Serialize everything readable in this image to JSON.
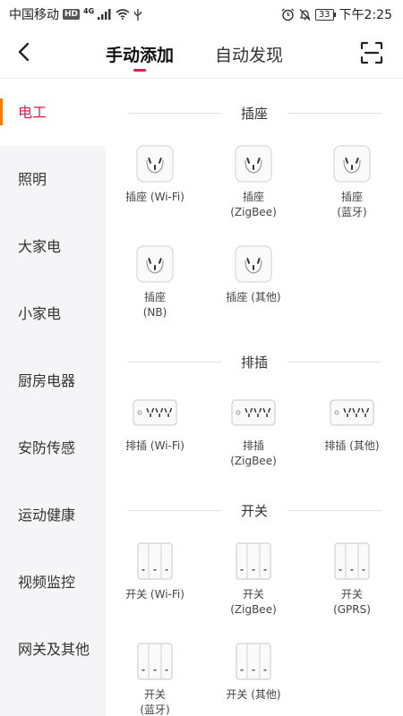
{
  "status_bar": {
    "carrier": "中国移动",
    "hd": "HD",
    "network": "4G",
    "battery": "33",
    "time": "下午2:25"
  },
  "header": {
    "tabs": [
      {
        "label": "手动添加",
        "active": true
      },
      {
        "label": "自动发现",
        "active": false
      }
    ],
    "back_icon": "chevron-left-icon",
    "scan_icon": "scan-icon",
    "accent_color": "#d81e4f"
  },
  "sidebar": {
    "items": [
      {
        "label": "电工",
        "active": true
      },
      {
        "label": "照明"
      },
      {
        "label": "大家电"
      },
      {
        "label": "小家电"
      },
      {
        "label": "厨房电器"
      },
      {
        "label": "安防传感"
      },
      {
        "label": "运动健康"
      },
      {
        "label": "视频监控"
      },
      {
        "label": "网关及其他"
      }
    ]
  },
  "sections": [
    {
      "title": "插座",
      "icon": "socket-icon",
      "devices": [
        {
          "label": "插座 (Wi-Fi)"
        },
        {
          "label": "插座\n(ZigBee)"
        },
        {
          "label": "插座\n(蓝牙)"
        },
        {
          "label": "插座\n(NB)"
        },
        {
          "label": "插座 (其他)"
        }
      ]
    },
    {
      "title": "排插",
      "icon": "power-strip-icon",
      "devices": [
        {
          "label": "排插 (Wi-Fi)"
        },
        {
          "label": "排插\n(ZigBee)"
        },
        {
          "label": "排插 (其他)"
        }
      ]
    },
    {
      "title": "开关",
      "icon": "wall-switch-icon",
      "devices": [
        {
          "label": "开关 (Wi-Fi)"
        },
        {
          "label": "开关\n(ZigBee)"
        },
        {
          "label": "开关\n(GPRS)"
        },
        {
          "label": "开关\n(蓝牙)"
        },
        {
          "label": "开关 (其他)"
        }
      ]
    }
  ]
}
